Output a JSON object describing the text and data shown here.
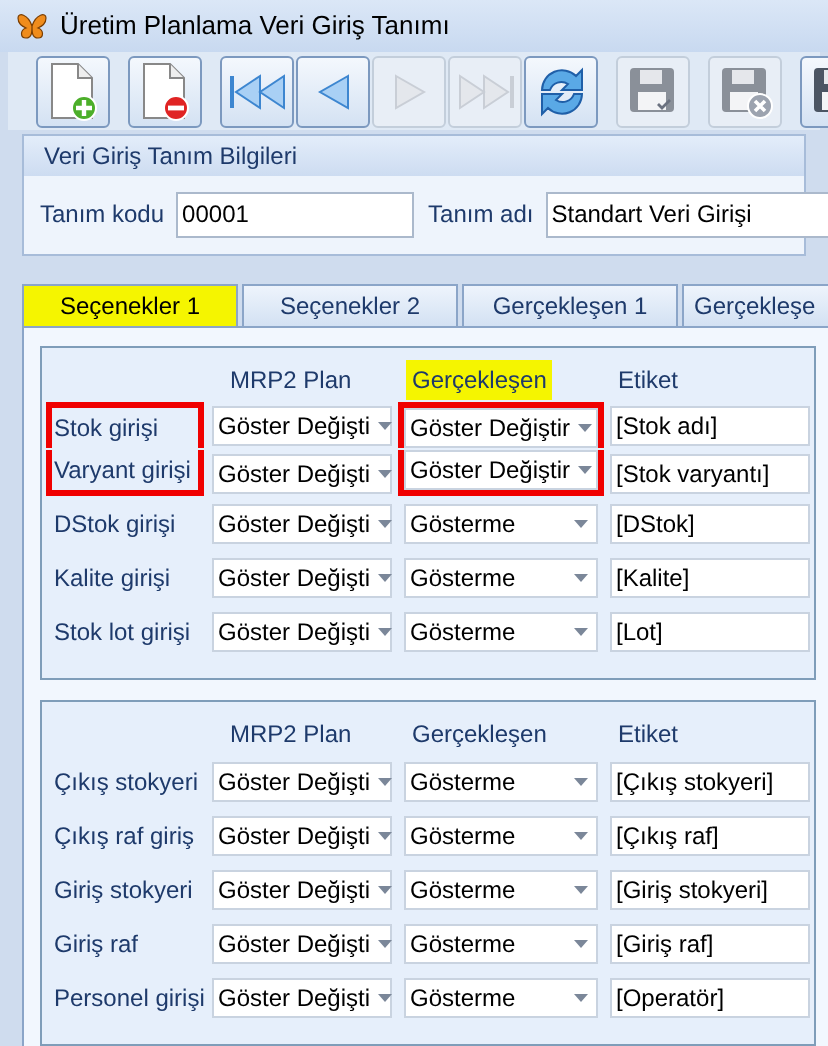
{
  "window": {
    "title": "Üretim Planlama Veri Giriş Tanımı"
  },
  "toolbar": [
    [
      {
        "kind": "new",
        "disabled": false
      }
    ],
    [
      {
        "kind": "delete",
        "disabled": false
      }
    ],
    [
      {
        "kind": "first",
        "disabled": false
      },
      {
        "kind": "prev",
        "disabled": false
      },
      {
        "kind": "next",
        "disabled": true
      },
      {
        "kind": "last",
        "disabled": true
      },
      {
        "kind": "refresh",
        "disabled": false
      }
    ],
    [
      {
        "kind": "save",
        "disabled": true
      }
    ],
    [
      {
        "kind": "cancel",
        "disabled": true
      }
    ],
    [
      {
        "kind": "save",
        "disabled": false
      }
    ]
  ],
  "info_panel": {
    "title": "Veri Giriş Tanım Bilgileri",
    "code_label": "Tanım kodu",
    "code_value": "00001",
    "name_label": "Tanım adı",
    "name_value": "Standart Veri Girişi"
  },
  "tabs": [
    {
      "label": "Seçenekler 1",
      "selected": true
    },
    {
      "label": "Seçenekler 2",
      "selected": false
    },
    {
      "label": "Gerçekleşen 1",
      "selected": false
    },
    {
      "label": "Gerçekleşe",
      "selected": false
    }
  ],
  "groups": [
    {
      "columns": [
        {
          "label": "MRP2 Plan",
          "highlighted": false
        },
        {
          "label": "Gerçekleşen",
          "highlighted": true
        },
        {
          "label": "Etiket",
          "highlighted": false
        }
      ],
      "rows": [
        {
          "label": "Stok girişi",
          "plan": "Göster Değişti",
          "actual": "Göster Değiştir",
          "tag": "[Stok adı]",
          "marked": true
        },
        {
          "label": "Varyant girişi",
          "plan": "Göster Değişti",
          "actual": "Göster Değiştir",
          "tag": "[Stok varyantı]",
          "marked": true
        },
        {
          "label": "DStok girişi",
          "plan": "Göster Değişti",
          "actual": "Gösterme",
          "tag": "[DStok]",
          "marked": false
        },
        {
          "label": "Kalite girişi",
          "plan": "Göster Değişti",
          "actual": "Gösterme",
          "tag": "[Kalite]",
          "marked": false
        },
        {
          "label": "Stok lot girişi",
          "plan": "Göster Değişti",
          "actual": "Gösterme",
          "tag": "[Lot]",
          "marked": false
        }
      ]
    },
    {
      "columns": [
        {
          "label": "MRP2 Plan",
          "highlighted": false
        },
        {
          "label": "Gerçekleşen",
          "highlighted": false
        },
        {
          "label": "Etiket",
          "highlighted": false
        }
      ],
      "rows": [
        {
          "label": "Çıkış stokyeri",
          "plan": "Göster Değişti",
          "actual": "Gösterme",
          "tag": "[Çıkış stokyeri]",
          "marked": false
        },
        {
          "label": "Çıkış raf giriş",
          "plan": "Göster Değişti",
          "actual": "Gösterme",
          "tag": "[Çıkış raf]",
          "marked": false
        },
        {
          "label": "Giriş stokyeri",
          "plan": "Göster Değişti",
          "actual": "Gösterme",
          "tag": "[Giriş stokyeri]",
          "marked": false
        },
        {
          "label": "Giriş raf",
          "plan": "Göster Değişti",
          "actual": "Gösterme",
          "tag": "[Giriş raf]",
          "marked": false
        },
        {
          "label": "Personel girişi",
          "plan": "Göster Değişti",
          "actual": "Gösterme",
          "tag": "[Operatör]",
          "marked": false
        }
      ]
    }
  ]
}
